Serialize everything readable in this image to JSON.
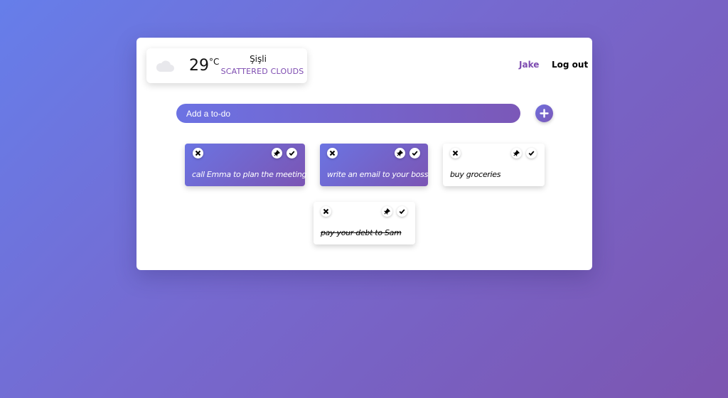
{
  "weather": {
    "temperature": "29",
    "unit": "°C",
    "city": "Şişli",
    "conditions": "SCATTERED CLOUDS",
    "icon": "cloud-icon"
  },
  "header": {
    "user_name": "Jake",
    "logout_label": "Log out"
  },
  "input": {
    "placeholder": "Add a to-do",
    "add_icon": "plus-icon"
  },
  "todos": [
    {
      "text": "call Emma to plan the meeting",
      "style": "purple",
      "done": false
    },
    {
      "text": "write an email to your boss",
      "style": "purple",
      "done": false
    },
    {
      "text": "buy groceries",
      "style": "white",
      "done": false
    },
    {
      "text": "pay your debt to Sam",
      "style": "white",
      "done": true
    }
  ],
  "colors": {
    "accent": "#7d4bb0",
    "gradient_start": "#667eea",
    "gradient_end": "#7c55b0"
  }
}
